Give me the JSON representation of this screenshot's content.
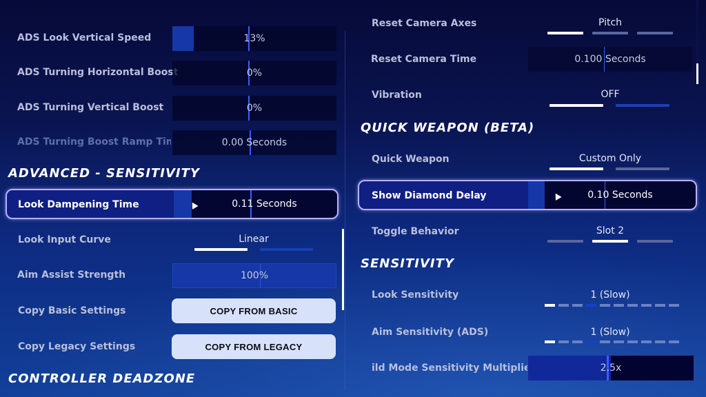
{
  "left": {
    "rows": [
      {
        "label": "ADS Look Vertical Speed",
        "value": "13%",
        "fill": 0.13
      },
      {
        "label": "ADS Turning Horizontal Boost",
        "value": "0%",
        "fill": 0
      },
      {
        "label": "ADS Turning Vertical Boost",
        "value": "0%",
        "fill": 0
      },
      {
        "label": "ADS Turning Boost Ramp Tim",
        "value": "0.00 Seconds",
        "fill": 0
      }
    ],
    "advanced_title": "ADVANCED - SENSITIVITY",
    "look_dampening": {
      "label": "Look Dampening Time",
      "value": "0.11 Seconds",
      "fill": 0.11
    },
    "look_input_curve": {
      "label": "Look Input Curve",
      "value": "Linear",
      "options_count": 2,
      "selected_index": 0
    },
    "aim_assist": {
      "label": "Aim Assist Strength",
      "value": "100%",
      "fill": 1.0
    },
    "copy_basic": {
      "label": "Copy Basic Settings",
      "button": "COPY FROM BASIC"
    },
    "copy_legacy": {
      "label": "Copy Legacy Settings",
      "button": "COPY FROM LEGACY"
    },
    "deadzone_title": "CONTROLLER DEADZONE"
  },
  "right": {
    "reset_axes": {
      "label": "Reset Camera Axes",
      "value": "Pitch",
      "options_count": 3,
      "selected_index": 0
    },
    "reset_time": {
      "label": "Reset Camera Time",
      "value": "0.100 Seconds"
    },
    "vibration": {
      "label": "Vibration",
      "value": "OFF",
      "options_count": 2,
      "selected_index": 0
    },
    "quick_weapon_title": "QUICK WEAPON (BETA)",
    "quick_weapon": {
      "label": "Quick Weapon",
      "value": "Custom Only",
      "options_count": 2,
      "selected_index": 0
    },
    "diamond_delay": {
      "label": "Show Diamond Delay",
      "value": "0.10 Seconds"
    },
    "toggle_behavior": {
      "label": "Toggle Behavior",
      "value": "Slot 2",
      "options_count": 3,
      "selected_index": 1
    },
    "sensitivity_title": "SENSITIVITY",
    "look_sens": {
      "label": "Look Sensitivity",
      "value": "1 (Slow)",
      "level": 1,
      "max": 10
    },
    "aim_sens": {
      "label": "Aim Sensitivity (ADS)",
      "value": "1 (Slow)",
      "level": 1,
      "max": 10
    },
    "build_mult": {
      "label": "ild Mode Sensitivity Multiplier",
      "value": "2.5x"
    }
  }
}
